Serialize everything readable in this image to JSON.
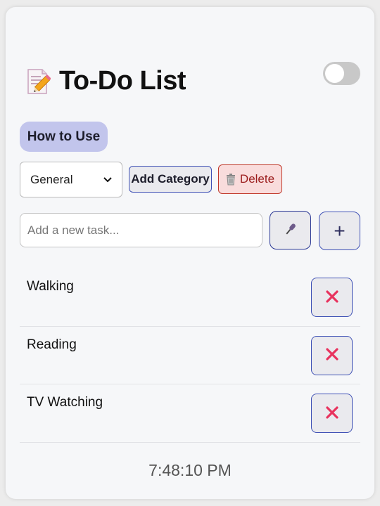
{
  "app": {
    "title": "To-Do List",
    "dark_mode_on": false
  },
  "help_button_label": "How to Use",
  "category": {
    "selected": "General",
    "add_label": "Add Category",
    "delete_label": "Delete"
  },
  "new_task": {
    "placeholder": "Add a new task...",
    "value": "",
    "add_label": "+"
  },
  "tasks": [
    {
      "text": "Walking"
    },
    {
      "text": "Reading"
    },
    {
      "text": "TV Watching"
    }
  ],
  "clock": "7:48:10 PM",
  "colors": {
    "accent": "#3f51b5",
    "help_bg": "#c2c5ec",
    "delete_bg": "#f9dcdc",
    "delete_text": "#9b1c1c",
    "remove_x": "#e8335e"
  }
}
